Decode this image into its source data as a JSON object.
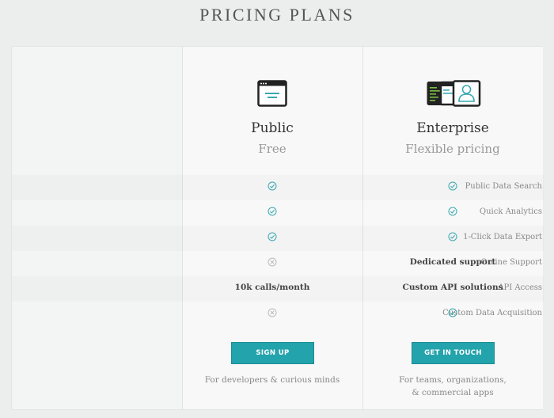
{
  "header": {
    "title": "PRICING PLANS"
  },
  "features": [
    "Public Data Search",
    "Quick Analytics",
    "1-Click Data Export",
    "Online Support",
    "API Access",
    "Custom Data Acquisition"
  ],
  "plans": [
    {
      "name": "Public",
      "price": "Free",
      "icon": "browser-window-icon",
      "cells": [
        {
          "type": "check"
        },
        {
          "type": "check"
        },
        {
          "type": "check"
        },
        {
          "type": "cross"
        },
        {
          "type": "text",
          "text": "10k calls/month"
        },
        {
          "type": "cross"
        }
      ],
      "button_label": "SIGN UP",
      "tagline": "For developers & curious minds"
    },
    {
      "name": "Enterprise",
      "price": "Flexible pricing",
      "icon": "multi-window-user-icon",
      "cells": [
        {
          "type": "check"
        },
        {
          "type": "check"
        },
        {
          "type": "check"
        },
        {
          "type": "text",
          "text": "Dedicated support"
        },
        {
          "type": "text",
          "text": "Custom API solutions"
        },
        {
          "type": "check"
        }
      ],
      "button_label": "GET IN TOUCH",
      "tagline_line1": "For teams, organizations,",
      "tagline_line2": "& commercial apps"
    }
  ],
  "colors": {
    "accent": "#23a3ac",
    "check": "#3aa8b0",
    "cross": "#bbbbbb"
  }
}
